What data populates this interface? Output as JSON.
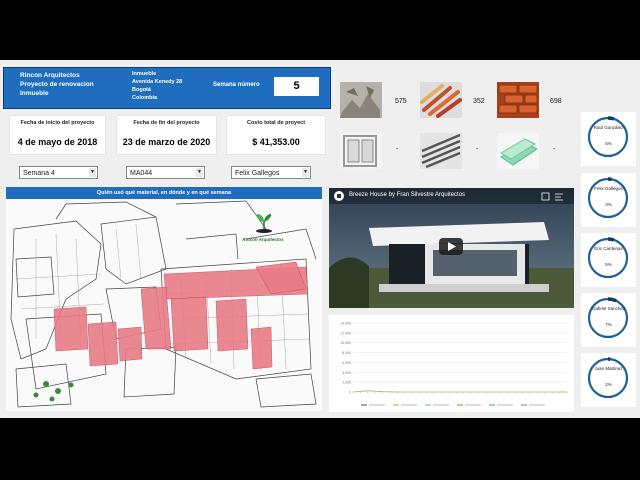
{
  "header": {
    "company": "Rincon Arquitectos",
    "project": "Proyecto de renovacion",
    "type": "Inmueble",
    "property_label": "Inmueble",
    "address": "Avenida Kenedy 28",
    "city": "Bogotá",
    "country": "Colombia",
    "week_label": "Semana número",
    "week_value": "5"
  },
  "cards": {
    "start_label": "Fecha de inicio del proyecto",
    "start_value": "4 de mayo de 2018",
    "end_label": "Fecha de fin del proyecto",
    "end_value": "23 de marzo de 2020",
    "cost_label": "Costo total de proyect",
    "cost_value": "$ 41,353.00"
  },
  "filters": {
    "week": "Semana 4",
    "material": "MA044",
    "person": "Felix Gallegos"
  },
  "plan": {
    "title": "Quién usó qué material, en dónde y en qué semana",
    "logo_text": "Rincon Arquitectos"
  },
  "materials": {
    "counts": [
      "575",
      "352",
      "698"
    ],
    "dashes": [
      "-",
      "-",
      "-"
    ]
  },
  "video": {
    "title": "Breeze House by Fran Silvestre Arquitectos"
  },
  "chart_data": {
    "type": "line",
    "ylim": [
      0,
      14000
    ],
    "yticks": [
      "14,000",
      "12,000",
      "10,000",
      "8,000",
      "6,000",
      "4,000",
      "2,000",
      "0"
    ],
    "series_points": [
      0,
      120,
      260,
      180,
      90,
      40,
      0,
      0,
      0,
      0,
      0,
      0,
      0,
      0,
      0,
      0,
      0,
      0,
      0,
      0,
      0,
      0,
      0,
      0,
      0,
      0,
      0,
      0,
      0,
      0
    ]
  },
  "people": [
    {
      "name": "Raul González",
      "pct": "5%",
      "frac": 0.05
    },
    {
      "name": "Felix Gallegos",
      "pct": "3%",
      "frac": 0.03
    },
    {
      "name": "Eric Cardenas",
      "pct": "5%",
      "frac": 0.05
    },
    {
      "name": "Gabriel Sanchez",
      "pct": "7%",
      "frac": 0.07
    },
    {
      "name": "Juan Martinez",
      "pct": "2%",
      "frac": 0.02
    }
  ],
  "colors": {
    "accent": "#1f6dbf",
    "highlight": "#e87b86",
    "ring": "#1f5f9c"
  }
}
